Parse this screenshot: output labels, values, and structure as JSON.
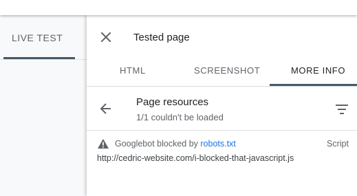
{
  "left_tab": {
    "label": "LIVE TEST"
  },
  "panel": {
    "title": "Tested page",
    "tabs": [
      {
        "label": "HTML"
      },
      {
        "label": "SCREENSHOT"
      },
      {
        "label": "MORE INFO"
      }
    ],
    "active_tab": "MORE INFO"
  },
  "resources": {
    "title": "Page resources",
    "subtitle": "1/1 couldn't be loaded",
    "items": [
      {
        "status_prefix": "Googlebot blocked by ",
        "status_link": "robots.txt",
        "type": "Script",
        "url": "http://cedric-website.com/i-blocked-that-javascript.js"
      }
    ]
  },
  "colors": {
    "accent": "#455a64",
    "link": "#1a73e8",
    "warning_icon": "#5f6368"
  },
  "icons": {
    "close": "close-icon",
    "back": "arrow-back-icon",
    "filter": "filter-icon",
    "warning": "warning-icon"
  }
}
